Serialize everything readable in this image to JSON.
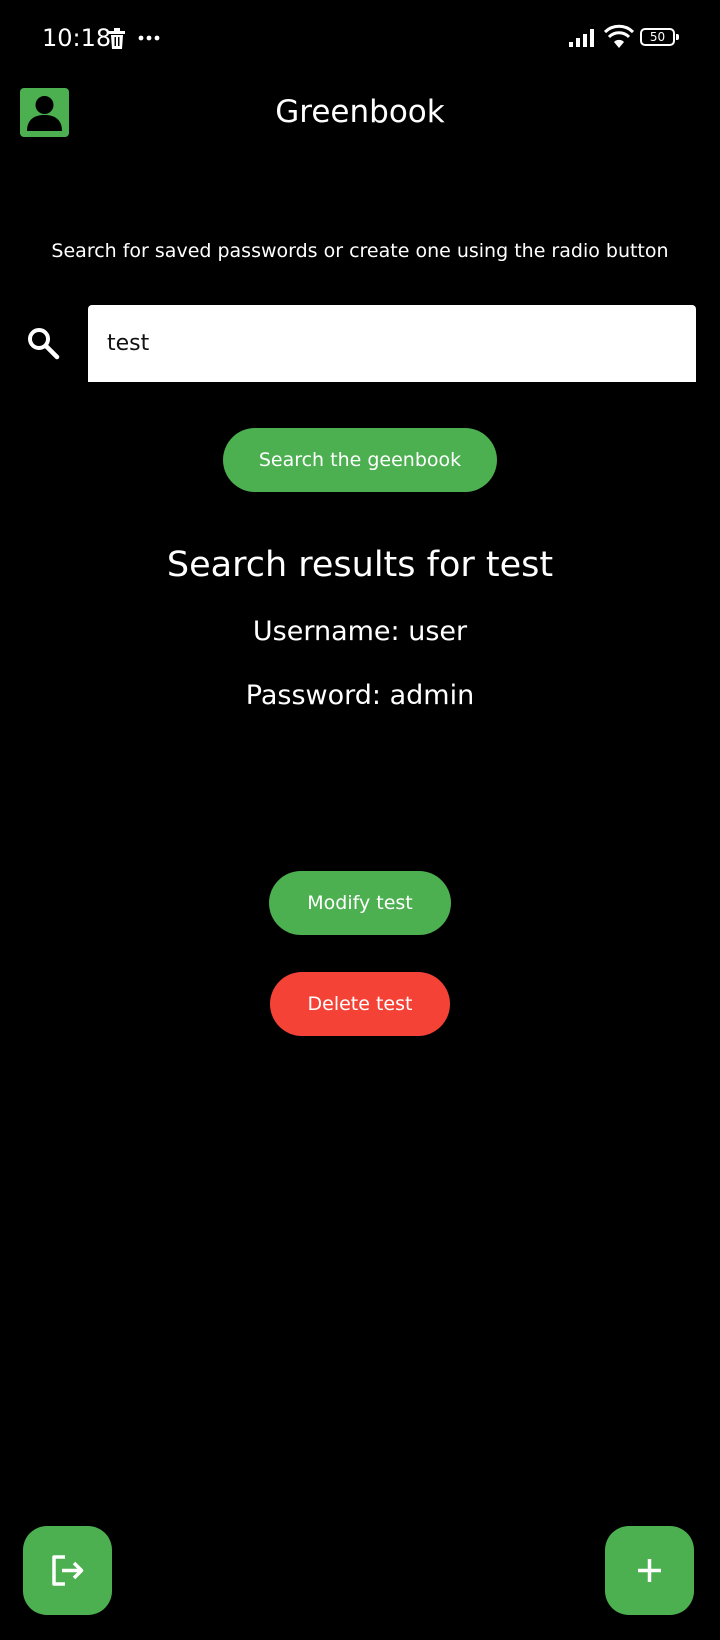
{
  "status_bar": {
    "time": "10:18",
    "battery": "50",
    "icons": [
      "trash-icon",
      "more-dots-icon",
      "signal-icon",
      "wifi-icon",
      "battery-icon"
    ]
  },
  "header": {
    "title": "Greenbook",
    "profile_icon": "account-box-icon"
  },
  "main": {
    "subtitle": "Search for saved passwords or create one using the radio button",
    "search": {
      "icon": "search-icon",
      "value": "test",
      "placeholder": ""
    },
    "search_button_label": "Search the geenbook",
    "results": {
      "heading": "Search results for test",
      "username_line": "Username: user",
      "password_line": "Password: admin"
    },
    "modify_button_label": "Modify test",
    "delete_button_label": "Delete test"
  },
  "fabs": {
    "logout_icon": "logout-icon",
    "add_icon": "plus-icon"
  },
  "colors": {
    "background": "#000000",
    "accent_green": "#4caf50",
    "danger_red": "#f44336",
    "text": "#ffffff"
  }
}
